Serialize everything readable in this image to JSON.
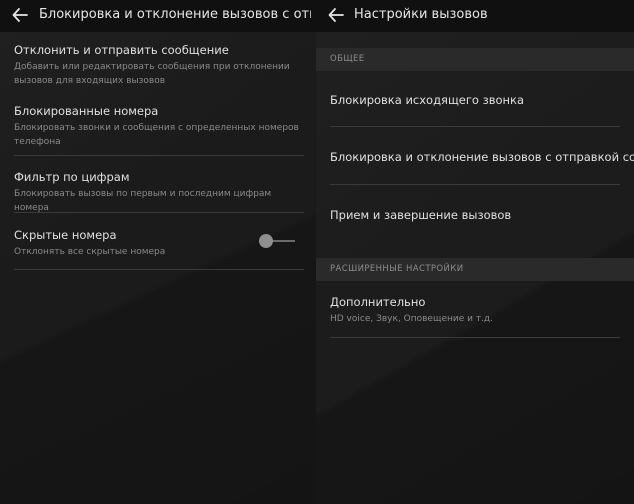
{
  "left_screen": {
    "title": "Блокировка и отклонение вызовов с отправк...",
    "items": [
      {
        "title": "Отклонить и отправить сообщение",
        "subtitle": "Добавить или редактировать сообщения при отклонении вызовов для входящих вызовов"
      },
      {
        "title": "Блокированные номера",
        "subtitle": "Блокировать звонки и сообщения с определенных номеров телефона"
      },
      {
        "title": "Фильтр по цифрам",
        "subtitle": "Блокировать вызовы по первым и последним цифрам номера"
      },
      {
        "title": "Скрытые номера",
        "subtitle": "Отклонять все скрытые номера",
        "toggle_on": false
      }
    ]
  },
  "right_screen": {
    "title": "Настройки вызовов",
    "sections": [
      {
        "header": "ОБЩЕЕ",
        "items": [
          {
            "title": "Блокировка исходящего звонка"
          },
          {
            "title": "Блокировка и отклонение вызовов с отправкой сообщения"
          },
          {
            "title": "Прием и завершение вызовов"
          }
        ]
      },
      {
        "header": "РАСШИРЕННЫЕ НАСТРОЙКИ",
        "items": [
          {
            "title": "Дополнительно",
            "subtitle": "HD voice, Звук, Оповещение и т.д."
          }
        ]
      }
    ]
  },
  "icons": {
    "back": "arrow-left-icon"
  },
  "colors": {
    "background": "#1b1b1b",
    "topbar": "#101010",
    "section_header": "#2a2a2a",
    "primary_text": "#e0e0e0",
    "secondary_text": "#8a8a8a"
  }
}
